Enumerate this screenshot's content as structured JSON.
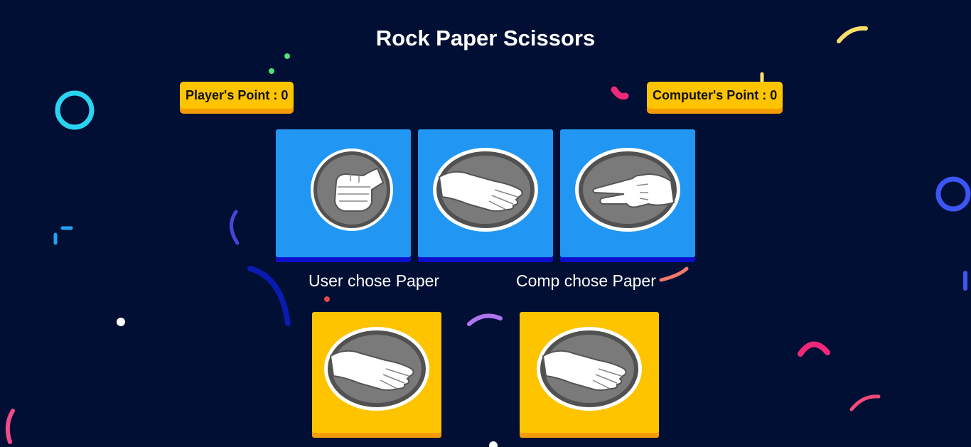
{
  "title": "Rock Paper Scissors",
  "scores": {
    "player_label": "Player's Point : 0",
    "computer_label": "Computer's Point : 0"
  },
  "choices": [
    {
      "name": "rock",
      "icon": "rock-hand-icon"
    },
    {
      "name": "paper",
      "icon": "paper-hand-icon"
    },
    {
      "name": "scissors",
      "icon": "scissors-hand-icon"
    }
  ],
  "messages": {
    "user": "User chose Paper",
    "computer": "Comp chose Paper"
  },
  "results": {
    "user_icon": "paper-hand-icon",
    "computer_icon": "paper-hand-icon"
  },
  "colors": {
    "background": "#000f33",
    "choice_card": "#2196f3",
    "result_card": "#fec400",
    "score_badge": "#fec400"
  }
}
